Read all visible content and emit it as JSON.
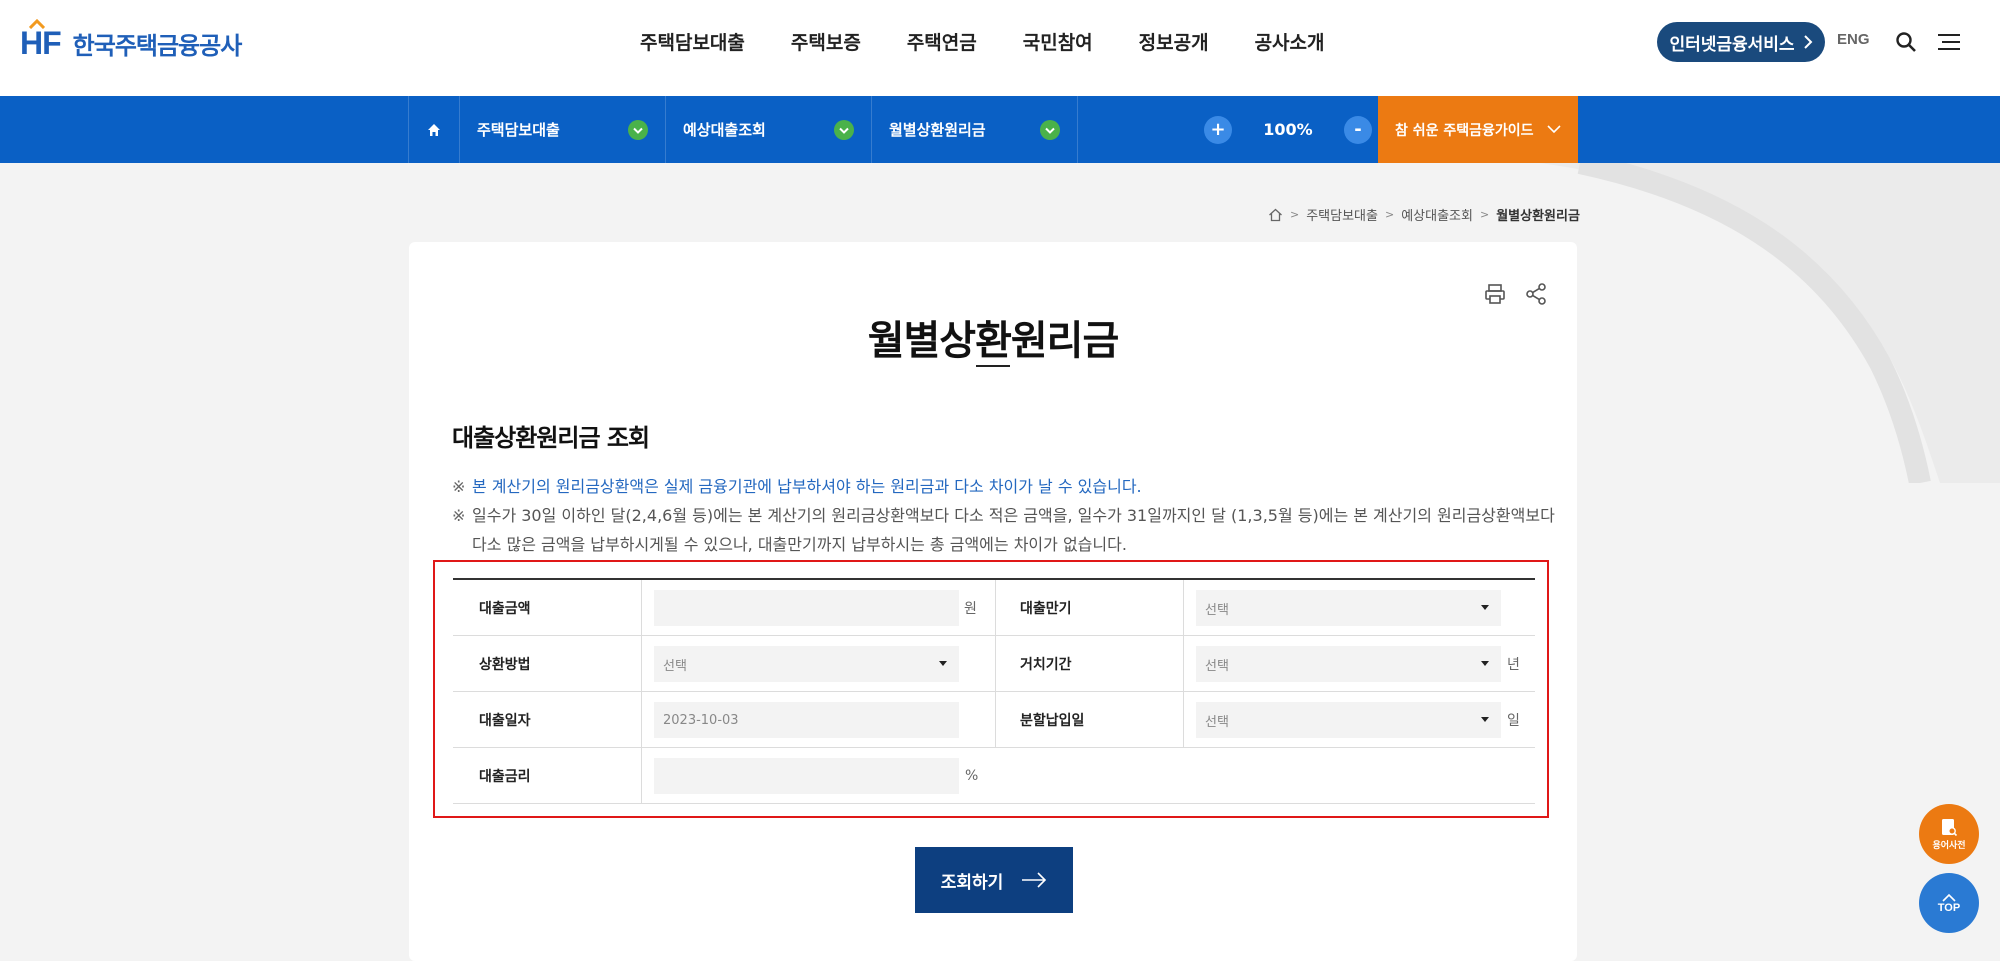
{
  "header": {
    "logo_mark": "HF",
    "logo_text": "한국주택금융공사",
    "nav": [
      "주택담보대출",
      "주택보증",
      "주택연금",
      "국민참여",
      "정보공개",
      "공사소개"
    ],
    "internet_service": "인터넷금융서비스",
    "lang": "ENG",
    "icons": {
      "search": "search-icon",
      "menu": "hamburger-menu-icon"
    }
  },
  "locbar": {
    "home_icon": "home-icon",
    "dropdowns": [
      "주택담보대출",
      "예상대출조회",
      "월별상환원리금"
    ],
    "zoom_in": "+",
    "zoom_value": "100%",
    "zoom_out": "-",
    "guide": "참 쉬운 주택금융가이드"
  },
  "breadcrumb": [
    "주택담보대출",
    "예상대출조회",
    "월별상환원리금"
  ],
  "page": {
    "title": "월별상환원리금",
    "section_title": "대출상환원리금 조회",
    "note_mark": "※",
    "notes": [
      "본 계산기의 원리금상환액은 실제 금융기관에 납부하셔야 하는 원리금과 다소 차이가 날 수 있습니다.",
      "일수가 30일 이하인 달(2,4,6월 등)에는 본 계산기의 원리금상환액보다 다소 적은 금액을, 일수가 31일까지인 달 (1,3,5월 등)에는 본 계산기의 원리금상환액보다",
      "다소 많은 금액을 납부하시게될 수 있으나, 대출만기까지 납부하시는 총 금액에는 차이가 없습니다."
    ]
  },
  "form": {
    "loan_amount": {
      "label": "대출금액",
      "value": "",
      "unit": "원"
    },
    "loan_term": {
      "label": "대출만기",
      "value": "선택"
    },
    "repay_method": {
      "label": "상환방법",
      "value": "선택"
    },
    "grace_period": {
      "label": "거치기간",
      "value": "선택",
      "unit": "년"
    },
    "loan_date": {
      "label": "대출일자",
      "value": "2023-10-03"
    },
    "payment_day": {
      "label": "분할납입일",
      "value": "선택",
      "unit": "일"
    },
    "interest_rate": {
      "label": "대출금리",
      "value": "",
      "unit": "%"
    }
  },
  "search_button": "조회하기",
  "floating": {
    "dictionary": "용어사전",
    "top": "TOP"
  },
  "colors": {
    "brand_blue": "#0a60c5",
    "navy": "#0d3f80",
    "orange": "#ec7a12",
    "highlight_red": "#e01818",
    "dot_green": "#4ab24a"
  }
}
